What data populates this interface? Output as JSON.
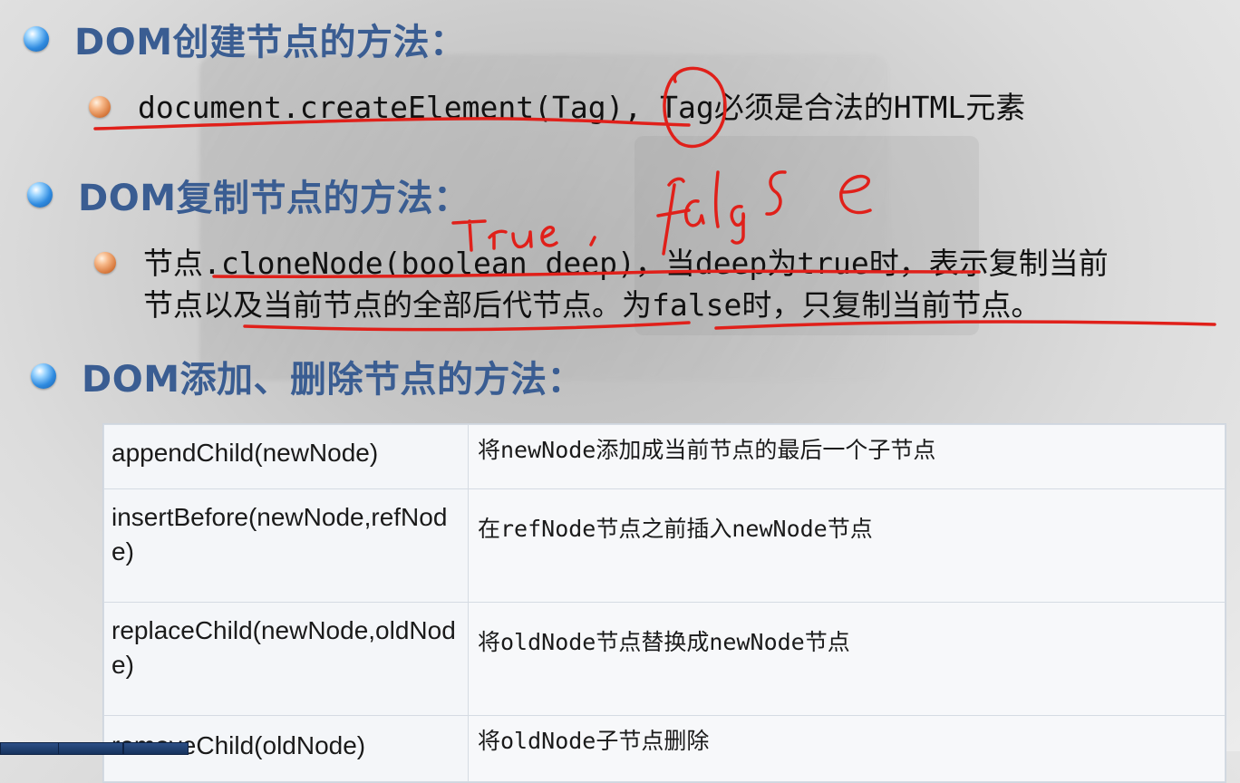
{
  "headings": {
    "create": "DOM创建节点的方法：",
    "clone": "DOM复制节点的方法：",
    "add_remove": "DOM添加、删除节点的方法："
  },
  "create_desc": "document.createElement(Tag), Tag必须是合法的HTML元素",
  "clone_desc_line1": "节点.cloneNode(boolean deep)，当deep为true时，表示复制当前",
  "clone_desc_line2": "节点以及当前节点的全部后代节点。为false时，只复制当前节点。",
  "methods_table": [
    {
      "method": "appendChild(newNode)",
      "description": "将newNode添加成当前节点的最后一个子节点"
    },
    {
      "method": "insertBefore(newNode,refNode)",
      "description": "在refNode节点之前插入newNode节点"
    },
    {
      "method": "replaceChild(newNode,oldNode)",
      "description": "将oldNode节点替换成newNode节点"
    },
    {
      "method": "removeChild(oldNode)",
      "description": "将oldNode子节点删除"
    }
  ],
  "annotations": {
    "true_text": "true",
    "false_text": "false",
    "ink_color": "#e0201a"
  },
  "colors": {
    "heading": "#3a5d92",
    "body_text": "#111111"
  },
  "icons": [
    "blue-sphere-bullet-icon",
    "orange-sphere-bullet-icon"
  ]
}
